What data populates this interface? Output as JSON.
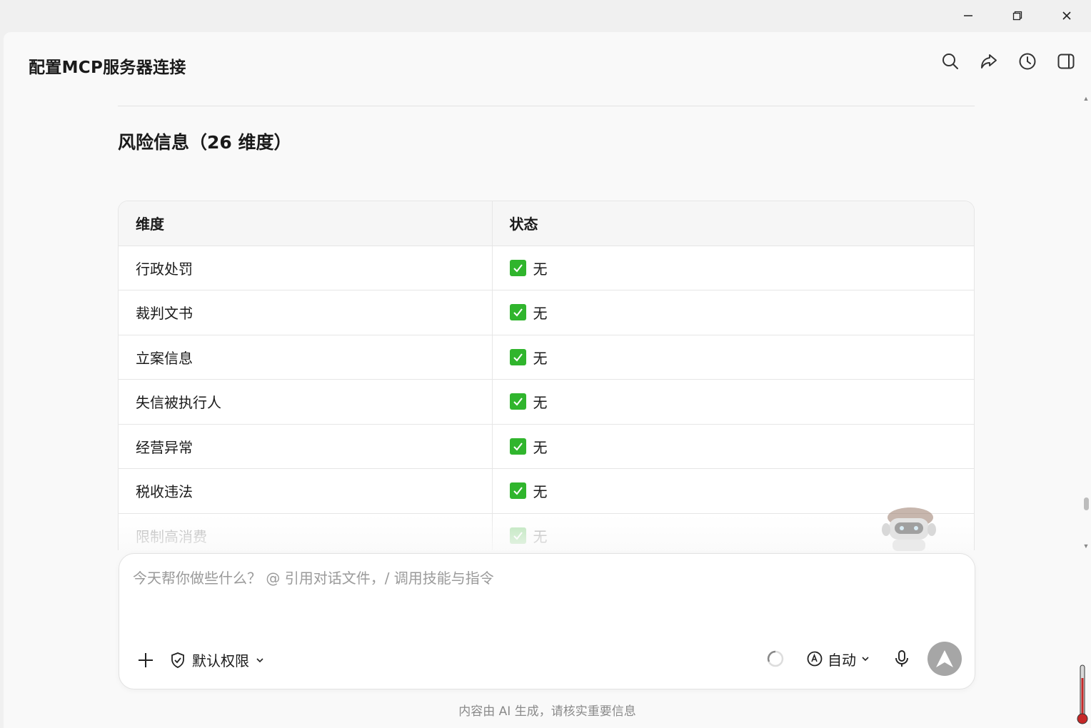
{
  "window": {
    "minimize_icon": "minimize-icon",
    "restore_icon": "restore-icon",
    "close_icon": "close-icon"
  },
  "header": {
    "title": "配置MCP服务器连接",
    "icons": [
      "search-icon",
      "share-icon",
      "history-icon",
      "sidebar-toggle-icon"
    ]
  },
  "section": {
    "title": "风险信息（26 维度）"
  },
  "table": {
    "headers": [
      "维度",
      "状态"
    ],
    "rows": [
      {
        "dimension": "行政处罚",
        "status": "无"
      },
      {
        "dimension": "裁判文书",
        "status": "无"
      },
      {
        "dimension": "立案信息",
        "status": "无"
      },
      {
        "dimension": "失信被执行人",
        "status": "无"
      },
      {
        "dimension": "经营异常",
        "status": "无"
      },
      {
        "dimension": "税收违法",
        "status": "无"
      },
      {
        "dimension": "限制高消费",
        "status": "无"
      }
    ],
    "check_color": "#30b52d"
  },
  "composer": {
    "placeholder": "今天帮你做些什么？ @ 引用对话文件，/ 调用技能与指令",
    "permission_label": "默认权限",
    "mode_label": "自动"
  },
  "footer": {
    "note": "内容由 AI 生成，请核实重要信息"
  }
}
